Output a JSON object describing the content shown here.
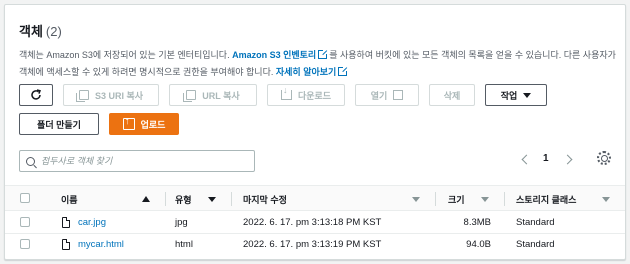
{
  "header": {
    "title": "객체",
    "count": "(2)"
  },
  "description": {
    "part1": "객체는 Amazon S3에 저장되어 있는 기본 엔터티입니다. ",
    "link1": "Amazon S3 인벤토리",
    "part2": "를 사용하여 버킷에 있는 모든 객체의 목록을 얻을 수 있습니다. 다른 사용자가 객체에 액세스할 수 있게 하려면 명시적으로 권한을 부여해야 합니다. ",
    "link2": "자세히 알아보기"
  },
  "toolbar": {
    "refresh_icon": "refresh-icon",
    "copy_s3_uri": "S3 URI 복사",
    "copy_url": "URL 복사",
    "download": "다운로드",
    "open": "열기",
    "delete": "삭제",
    "actions": "작업",
    "create_folder": "폴더 만들기",
    "upload": "업로드"
  },
  "search": {
    "placeholder": "접두사로 객체 찾기"
  },
  "pagination": {
    "current_page": "1"
  },
  "table": {
    "columns": [
      "이름",
      "유형",
      "마지막 수정",
      "크기",
      "스토리지 클래스"
    ],
    "rows": [
      {
        "name": "car.jpg",
        "type": "jpg",
        "modified": "2022. 6. 17. pm 3:13:18 PM KST",
        "size": "8.3MB",
        "storage_class": "Standard"
      },
      {
        "name": "mycar.html",
        "type": "html",
        "modified": "2022. 6. 17. pm 3:13:19 PM KST",
        "size": "94.0B",
        "storage_class": "Standard"
      }
    ]
  },
  "colors": {
    "accent": "#ec7211",
    "link": "#0073bb",
    "text": "#16191f"
  }
}
